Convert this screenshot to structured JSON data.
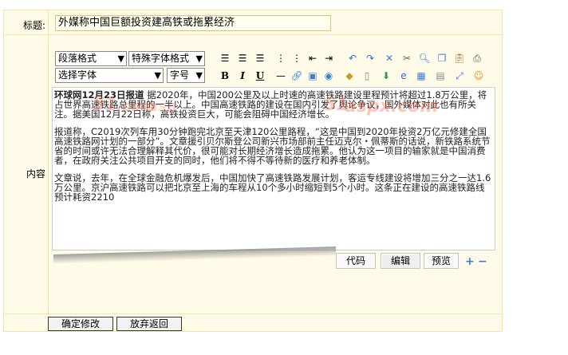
{
  "form": {
    "title_label": "标题:",
    "content_label": "内容",
    "title_value": "外媒称中国巨额投资建高铁或拖累经济"
  },
  "toolbar": {
    "paragraph_format": "段落格式",
    "special_font_format": "特殊字体格式",
    "font_select": "选择字体",
    "font_size": "字号",
    "bold": "B",
    "italic": "I",
    "underline": "U"
  },
  "editor": {
    "lead_bold": "环球网12月23日报道",
    "p1": "据2020年，中国200公里及以上时速的高速铁路建设里程预计将超过1.8万公里，将占世界高速铁路总里程的一半以上。中国高速铁路的建设在国内引发了舆论争议，国外媒体对此也有所关注。据美国12月22日称，高铁投资巨大，可能会阻碍中国经济增长。",
    "p2": "报道称，C2019次列车用30分钟跑完北京至天津120公里路程，“这是中国到2020年投资2万亿元修建全国高速铁路网计划的一部分”。文章援引贝尔斯登公司新兴市场部前主任迈克尔・佩蒂斯的话说，新铁路系统节省的时间或许无法合理解释其代价，很可能对长期经济增长造成拖累。他认为这一项目的输家就是中国消费者，在政府关注公共项目开支的同时，他们将不得不等待新的医疗和养老体制。",
    "p3": "文章说，去年，在全球金融危机爆发后，中国加快了高速铁路发展计划，客运专线建设将增加三分之一达1.6万公里。京沪高速铁路可以把北京至上海的车程从10个多小时缩短到5个小时。这条正在建设的高速铁路线预计耗资2210",
    "watermark_1": "51",
    "watermark_2": "51",
    "watermark_3": ".com",
    "watermark_4": "aspx.com",
    "watermark_5": "asp",
    "tab_code": "代码",
    "tab_edit": "编辑",
    "tab_preview": "预览",
    "plus": "+",
    "minus": "−"
  },
  "buttons": {
    "confirm": "确定修改",
    "cancel": "放弃返回"
  },
  "colors": {
    "form_bg": "#fffbe8",
    "border": "#f3e6a8",
    "watermark": "#ff5a3c",
    "accent_blue": "#3b7bcf"
  }
}
